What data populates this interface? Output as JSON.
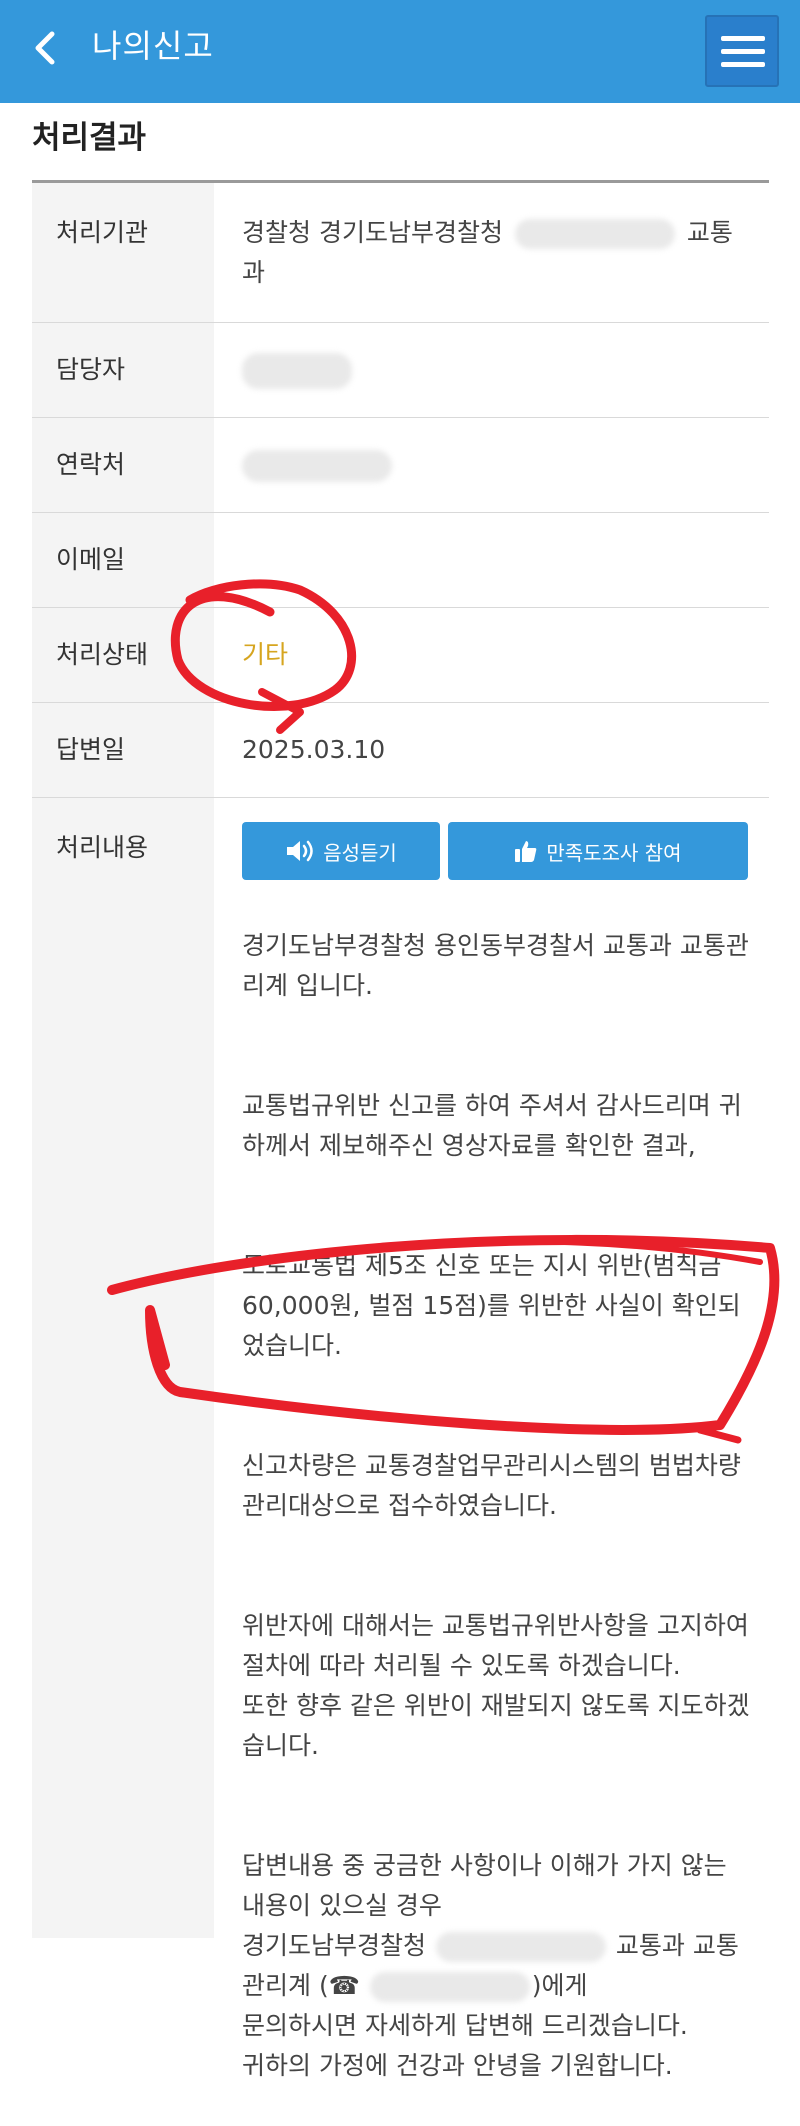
{
  "header": {
    "title": "나의신고"
  },
  "section": {
    "title": "처리결과"
  },
  "rows": {
    "agency": {
      "label": "처리기관",
      "value_prefix": "경찰청 경기도남부경찰청",
      "value_suffix": "교통",
      "value_line2": "과"
    },
    "manager": {
      "label": "담당자"
    },
    "contact": {
      "label": "연락처"
    },
    "email": {
      "label": "이메일"
    },
    "status": {
      "label": "처리상태",
      "value": "기타"
    },
    "answer_date": {
      "label": "답변일",
      "value": "2025.03.10"
    },
    "content": {
      "label": "처리내용",
      "voice_button": "음성듣기",
      "survey_button": "만족도조사 참여",
      "paragraphs": [
        "경기도남부경찰청 용인동부경찰서 교통과 교통관리계 입니다.",
        "교통법규위반 신고를 하여 주셔서 감사드리며 귀하께서 제보해주신 영상자료를 확인한 결과,",
        "도로교통법 제5조 신호 또는 지시 위반(범칙금 60,000원, 벌점 15점)를 위반한 사실이 확인되었습니다.",
        "신고차량은 교통경찰업무관리시스템의 범법차량 관리대상으로 접수하였습니다.",
        "위반자에 대해서는 교통법규위반사항을 고지하여 절차에 따라 처리될 수 있도록 하겠습니다.\n또한 향후 같은 위반이 재발되지 않도록 지도하겠습니다."
      ],
      "closing": {
        "line1": "답변내용 중 궁금한 사항이나 이해가 가지 않는",
        "line2": "내용이 있으실 경우",
        "line3_prefix": "경기도남부경찰청",
        "line3_suffix": "교통과 교통",
        "line4_prefix": "관리계 (☎",
        "line4_suffix": ")에게",
        "line5": "문의하시면 자세하게 답변해 드리겠습니다.",
        "line6": "귀하의 가정에 건강과 안녕을 기원합니다."
      }
    }
  },
  "colors": {
    "header_bg": "#3498db",
    "status_value": "#d6a51f",
    "annotation": "#e8202a"
  }
}
